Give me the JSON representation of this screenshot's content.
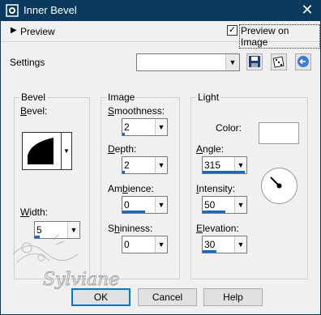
{
  "window": {
    "title": "Inner Bevel",
    "close_glyph": "✕"
  },
  "preview": {
    "toggle_glyph": "▶",
    "label": "Preview",
    "checkbox_label": "Preview on Image",
    "checked": true
  },
  "settings": {
    "label": "Settings",
    "value": ""
  },
  "bevel": {
    "group_title": "Bevel",
    "bevel_label_u": "B",
    "bevel_label_rest": "evel:",
    "width_label_u": "W",
    "width_label_rest": "idth:",
    "width_value": "5"
  },
  "image": {
    "group_title": "Image",
    "smoothness_u": "S",
    "smoothness_rest": "moothness:",
    "smoothness_value": "2",
    "depth_u": "D",
    "depth_rest": "epth:",
    "depth_value": "2",
    "ambience_pre": "Am",
    "ambience_u": "b",
    "ambience_rest": "ience:",
    "ambience_value": "0",
    "shininess_pre": "S",
    "shininess_u": "h",
    "shininess_rest": "ininess:",
    "shininess_value": "0"
  },
  "light": {
    "group_title": "Light",
    "color_label": "Color:",
    "color": "#ffffff",
    "angle_u": "A",
    "angle_rest": "ngle:",
    "angle_value": "315",
    "intensity_u": "I",
    "intensity_rest": "ntensity:",
    "intensity_value": "50",
    "elevation_u": "E",
    "elevation_rest": "levation:",
    "elevation_value": "30"
  },
  "buttons": {
    "ok": "OK",
    "cancel": "Cancel",
    "help": "Help"
  },
  "watermark": "Sylviane",
  "colors": {
    "titlebar": "#0a3a5d",
    "accent": "#0d69d3",
    "dialog_bg": "#f0f0f0"
  }
}
